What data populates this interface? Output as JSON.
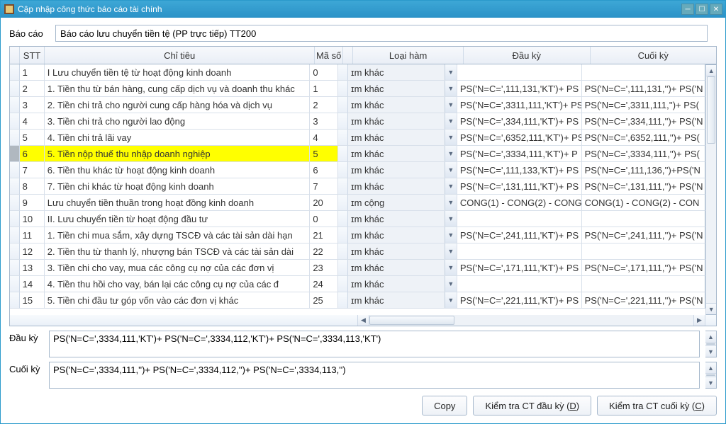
{
  "window": {
    "title": "Cập nhập công thức báo cáo tài chính"
  },
  "topfield": {
    "label": "Báo cáo",
    "value": "Báo cáo lưu chuyển tiền tệ (PP trực tiếp) TT200"
  },
  "headers": {
    "stt": "STT",
    "chi": "Chỉ tiêu",
    "maso": "Mã số",
    "ham": "Loại hàm",
    "dau": "Đầu kỳ",
    "cuoi": "Cuối kỳ"
  },
  "rows": [
    {
      "stt": "1",
      "chi": "I Lưu chuyển tiền tệ từ hoạt động kinh doanh",
      "maso": "0",
      "ham": "ɪm khác",
      "dau": "",
      "cuoi": "",
      "highlight": false,
      "sel": false
    },
    {
      "stt": "2",
      "chi": "1. Tiền thu từ bán hàng, cung cấp dịch vụ và doanh thu khác",
      "maso": "1",
      "ham": "ɪm khác",
      "dau": "PS('N=C=',111,131,'KT')+ PS",
      "cuoi": "PS('N=C=',111,131,'')+ PS('N",
      "highlight": false,
      "sel": false
    },
    {
      "stt": "3",
      "chi": "2. Tiền chi trả cho người cung cấp hàng hóa và dịch vụ",
      "maso": "2",
      "ham": "ɪm khác",
      "dau": "PS('N=C=',3311,111,'KT')+ PS",
      "cuoi": "PS('N=C=',3311,111,'')+ PS(",
      "highlight": false,
      "sel": false
    },
    {
      "stt": "4",
      "chi": "3. Tiền chi trả cho người lao động",
      "maso": "3",
      "ham": "ɪm khác",
      "dau": "PS('N=C=',334,111,'KT')+ PS",
      "cuoi": "PS('N=C=',334,111,'')+ PS('N",
      "highlight": false,
      "sel": false
    },
    {
      "stt": "5",
      "chi": "4. Tiền chi trả lãi vay",
      "maso": "4",
      "ham": "ɪm khác",
      "dau": "PS('N=C=',6352,111,'KT')+ PS",
      "cuoi": "PS('N=C=',6352,111,'')+ PS(",
      "highlight": false,
      "sel": false
    },
    {
      "stt": "6",
      "chi": "5. Tiền nộp thuế thu nhập doanh nghiệp",
      "maso": "5",
      "ham": "ɪm khác",
      "dau": "PS('N=C=',3334,111,'KT')+ P",
      "cuoi": "PS('N=C=',3334,111,'')+ PS(",
      "highlight": true,
      "sel": true
    },
    {
      "stt": "7",
      "chi": "6. Tiền thu khác từ hoạt động kinh doanh",
      "maso": "6",
      "ham": "ɪm khác",
      "dau": "PS('N=C=',111,133,'KT')+ PS",
      "cuoi": "PS('N=C=',111,136,'')+PS('N",
      "highlight": false,
      "sel": false
    },
    {
      "stt": "8",
      "chi": "7. Tiền chi khác từ hoạt động kinh doanh",
      "maso": "7",
      "ham": "ɪm khác",
      "dau": "PS('N=C=',131,111,'KT')+ PS",
      "cuoi": "PS('N=C=',131,111,'')+ PS('N",
      "highlight": false,
      "sel": false
    },
    {
      "stt": "9",
      "chi": "Lưu chuyển tiền thuần trong hoạt đồng kinh doanh",
      "maso": "20",
      "ham": "ɪm cộng",
      "dau": "CONG(1) - CONG(2) - CONG",
      "cuoi": "CONG(1) - CONG(2) - CON",
      "highlight": false,
      "sel": false
    },
    {
      "stt": "10",
      "chi": "II. Lưu chuyển tiền từ hoạt động đầu tư",
      "maso": "0",
      "ham": "ɪm khác",
      "dau": "",
      "cuoi": "",
      "highlight": false,
      "sel": false
    },
    {
      "stt": "11",
      "chi": "1. Tiền chi mua sắm, xây dựng TSCĐ và các tài sản dài hạn",
      "maso": "21",
      "ham": "ɪm khác",
      "dau": "PS('N=C=',241,111,'KT')+ PS",
      "cuoi": "PS('N=C=',241,111,'')+ PS('N",
      "highlight": false,
      "sel": false
    },
    {
      "stt": "12",
      "chi": "2. Tiền thu từ thanh lý, nhượng bán TSCĐ và các tài sản dài",
      "maso": "22",
      "ham": "ɪm khác",
      "dau": "",
      "cuoi": "",
      "highlight": false,
      "sel": false
    },
    {
      "stt": "13",
      "chi": "3. Tiền chi cho vay, mua các công cụ nợ của các đơn vị",
      "maso": "23",
      "ham": "ɪm khác",
      "dau": "PS('N=C=',171,111,'KT')+ PS",
      "cuoi": "PS('N=C=',171,111,'')+ PS('N",
      "highlight": false,
      "sel": false
    },
    {
      "stt": "14",
      "chi": "4. Tiền thu hồi cho vay, bán lại các công cụ nợ của các đ",
      "maso": "24",
      "ham": "ɪm khác",
      "dau": "",
      "cuoi": "",
      "highlight": false,
      "sel": false
    },
    {
      "stt": "15",
      "chi": "5. Tiền chi đầu tư góp vốn vào các đơn vị khác",
      "maso": "25",
      "ham": "ɪm khác",
      "dau": "PS('N=C=',221,111,'KT')+ PS",
      "cuoi": "PS('N=C=',221,111,'')+ PS('N",
      "highlight": false,
      "sel": false
    }
  ],
  "dauky": {
    "label": "Đầu kỳ",
    "value": "PS('N=C=',3334,111,'KT')+ PS('N=C=',3334,112,'KT')+ PS('N=C=',3334,113,'KT')"
  },
  "cuoiky": {
    "label": "Cuối kỳ",
    "value": "PS('N=C=',3334,111,'')+ PS('N=C=',3334,112,'')+ PS('N=C=',3334,113,'')"
  },
  "buttons": {
    "copy": "Copy",
    "check_dauky_pre": "Kiểm tra CT đầu kỳ (",
    "check_dauky_u": "D",
    "check_dauky_post": ")",
    "check_cuoiky_pre": "Kiểm tra CT cuối kỳ (",
    "check_cuoiky_u": "C",
    "check_cuoiky_post": ")"
  }
}
